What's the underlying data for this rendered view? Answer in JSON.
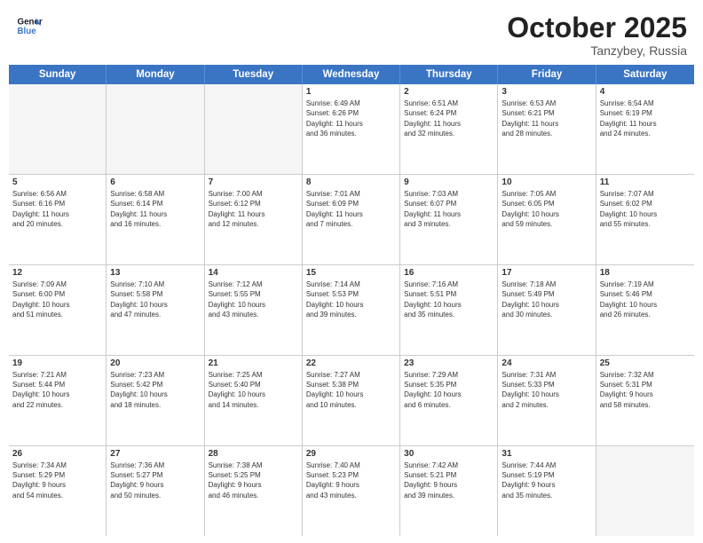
{
  "header": {
    "logo_line1": "General",
    "logo_line2": "Blue",
    "month": "October 2025",
    "location": "Tanzybey, Russia"
  },
  "weekdays": [
    "Sunday",
    "Monday",
    "Tuesday",
    "Wednesday",
    "Thursday",
    "Friday",
    "Saturday"
  ],
  "rows": [
    [
      {
        "day": "",
        "empty": true
      },
      {
        "day": "",
        "empty": true
      },
      {
        "day": "",
        "empty": true
      },
      {
        "day": "1",
        "lines": [
          "Sunrise: 6:49 AM",
          "Sunset: 6:26 PM",
          "Daylight: 11 hours",
          "and 36 minutes."
        ]
      },
      {
        "day": "2",
        "lines": [
          "Sunrise: 6:51 AM",
          "Sunset: 6:24 PM",
          "Daylight: 11 hours",
          "and 32 minutes."
        ]
      },
      {
        "day": "3",
        "lines": [
          "Sunrise: 6:53 AM",
          "Sunset: 6:21 PM",
          "Daylight: 11 hours",
          "and 28 minutes."
        ]
      },
      {
        "day": "4",
        "lines": [
          "Sunrise: 6:54 AM",
          "Sunset: 6:19 PM",
          "Daylight: 11 hours",
          "and 24 minutes."
        ]
      }
    ],
    [
      {
        "day": "5",
        "lines": [
          "Sunrise: 6:56 AM",
          "Sunset: 6:16 PM",
          "Daylight: 11 hours",
          "and 20 minutes."
        ]
      },
      {
        "day": "6",
        "lines": [
          "Sunrise: 6:58 AM",
          "Sunset: 6:14 PM",
          "Daylight: 11 hours",
          "and 16 minutes."
        ]
      },
      {
        "day": "7",
        "lines": [
          "Sunrise: 7:00 AM",
          "Sunset: 6:12 PM",
          "Daylight: 11 hours",
          "and 12 minutes."
        ]
      },
      {
        "day": "8",
        "lines": [
          "Sunrise: 7:01 AM",
          "Sunset: 6:09 PM",
          "Daylight: 11 hours",
          "and 7 minutes."
        ]
      },
      {
        "day": "9",
        "lines": [
          "Sunrise: 7:03 AM",
          "Sunset: 6:07 PM",
          "Daylight: 11 hours",
          "and 3 minutes."
        ]
      },
      {
        "day": "10",
        "lines": [
          "Sunrise: 7:05 AM",
          "Sunset: 6:05 PM",
          "Daylight: 10 hours",
          "and 59 minutes."
        ]
      },
      {
        "day": "11",
        "lines": [
          "Sunrise: 7:07 AM",
          "Sunset: 6:02 PM",
          "Daylight: 10 hours",
          "and 55 minutes."
        ]
      }
    ],
    [
      {
        "day": "12",
        "lines": [
          "Sunrise: 7:09 AM",
          "Sunset: 6:00 PM",
          "Daylight: 10 hours",
          "and 51 minutes."
        ]
      },
      {
        "day": "13",
        "lines": [
          "Sunrise: 7:10 AM",
          "Sunset: 5:58 PM",
          "Daylight: 10 hours",
          "and 47 minutes."
        ]
      },
      {
        "day": "14",
        "lines": [
          "Sunrise: 7:12 AM",
          "Sunset: 5:55 PM",
          "Daylight: 10 hours",
          "and 43 minutes."
        ]
      },
      {
        "day": "15",
        "lines": [
          "Sunrise: 7:14 AM",
          "Sunset: 5:53 PM",
          "Daylight: 10 hours",
          "and 39 minutes."
        ]
      },
      {
        "day": "16",
        "lines": [
          "Sunrise: 7:16 AM",
          "Sunset: 5:51 PM",
          "Daylight: 10 hours",
          "and 35 minutes."
        ]
      },
      {
        "day": "17",
        "lines": [
          "Sunrise: 7:18 AM",
          "Sunset: 5:49 PM",
          "Daylight: 10 hours",
          "and 30 minutes."
        ]
      },
      {
        "day": "18",
        "lines": [
          "Sunrise: 7:19 AM",
          "Sunset: 5:46 PM",
          "Daylight: 10 hours",
          "and 26 minutes."
        ]
      }
    ],
    [
      {
        "day": "19",
        "lines": [
          "Sunrise: 7:21 AM",
          "Sunset: 5:44 PM",
          "Daylight: 10 hours",
          "and 22 minutes."
        ]
      },
      {
        "day": "20",
        "lines": [
          "Sunrise: 7:23 AM",
          "Sunset: 5:42 PM",
          "Daylight: 10 hours",
          "and 18 minutes."
        ]
      },
      {
        "day": "21",
        "lines": [
          "Sunrise: 7:25 AM",
          "Sunset: 5:40 PM",
          "Daylight: 10 hours",
          "and 14 minutes."
        ]
      },
      {
        "day": "22",
        "lines": [
          "Sunrise: 7:27 AM",
          "Sunset: 5:38 PM",
          "Daylight: 10 hours",
          "and 10 minutes."
        ]
      },
      {
        "day": "23",
        "lines": [
          "Sunrise: 7:29 AM",
          "Sunset: 5:35 PM",
          "Daylight: 10 hours",
          "and 6 minutes."
        ]
      },
      {
        "day": "24",
        "lines": [
          "Sunrise: 7:31 AM",
          "Sunset: 5:33 PM",
          "Daylight: 10 hours",
          "and 2 minutes."
        ]
      },
      {
        "day": "25",
        "lines": [
          "Sunrise: 7:32 AM",
          "Sunset: 5:31 PM",
          "Daylight: 9 hours",
          "and 58 minutes."
        ]
      }
    ],
    [
      {
        "day": "26",
        "lines": [
          "Sunrise: 7:34 AM",
          "Sunset: 5:29 PM",
          "Daylight: 9 hours",
          "and 54 minutes."
        ]
      },
      {
        "day": "27",
        "lines": [
          "Sunrise: 7:36 AM",
          "Sunset: 5:27 PM",
          "Daylight: 9 hours",
          "and 50 minutes."
        ]
      },
      {
        "day": "28",
        "lines": [
          "Sunrise: 7:38 AM",
          "Sunset: 5:25 PM",
          "Daylight: 9 hours",
          "and 46 minutes."
        ]
      },
      {
        "day": "29",
        "lines": [
          "Sunrise: 7:40 AM",
          "Sunset: 5:23 PM",
          "Daylight: 9 hours",
          "and 43 minutes."
        ]
      },
      {
        "day": "30",
        "lines": [
          "Sunrise: 7:42 AM",
          "Sunset: 5:21 PM",
          "Daylight: 9 hours",
          "and 39 minutes."
        ]
      },
      {
        "day": "31",
        "lines": [
          "Sunrise: 7:44 AM",
          "Sunset: 5:19 PM",
          "Daylight: 9 hours",
          "and 35 minutes."
        ]
      },
      {
        "day": "",
        "empty": true
      }
    ]
  ]
}
